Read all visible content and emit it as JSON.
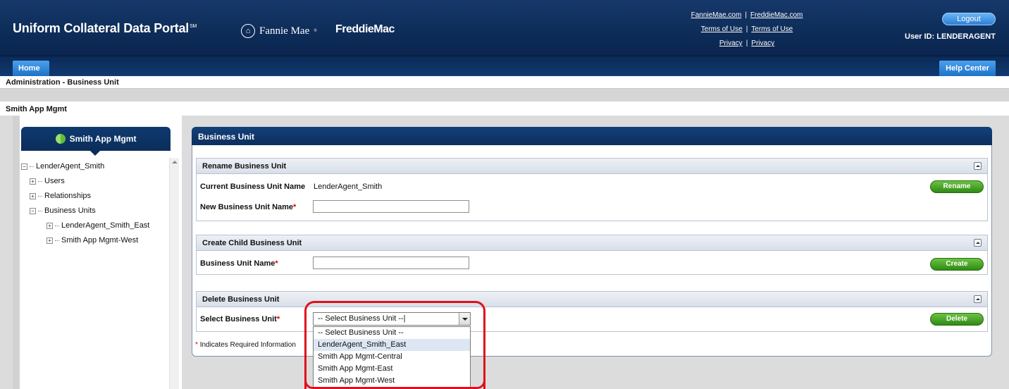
{
  "header": {
    "title": "Uniform Collateral Data Portal",
    "title_mark": "SM",
    "fannie_logo": "Fannie Mae",
    "freddie_logo": "FreddieMac",
    "links_row1": [
      "FannieMae.com",
      "FreddieMac.com"
    ],
    "links_row2": [
      "Terms of Use",
      "Terms of Use"
    ],
    "links_row3": [
      "Privacy",
      "Privacy"
    ],
    "separator": "|",
    "logout_label": "Logout",
    "user_id": "User ID: LENDERAGENT"
  },
  "nav": {
    "home_tab": "Home",
    "help_tab": "Help Center"
  },
  "breadcrumb": "Administration - Business Unit",
  "subtitle": "Smith App Mgmt",
  "left_panel": {
    "heading": "Smith App Mgmt",
    "tree": {
      "root": "LenderAgent_Smith",
      "children": [
        "Users",
        "Relationships",
        "Business Units"
      ],
      "business_units": [
        "LenderAgent_Smith_East",
        "Smith App Mgmt-West"
      ]
    }
  },
  "main": {
    "heading": "Business Unit",
    "rename": {
      "title": "Rename Business Unit",
      "current_label": "Current Business Unit Name",
      "current_value": "LenderAgent_Smith",
      "new_label": "New Business Unit Name",
      "new_value": "",
      "button": "Rename"
    },
    "create": {
      "title": "Create Child Business Unit",
      "name_label": "Business Unit Name",
      "name_value": "",
      "button": "Create"
    },
    "delete": {
      "title": "Delete Business Unit",
      "select_label": "Select Business Unit",
      "select_value": "-- Select Business Unit --|",
      "options": [
        "-- Select Business Unit --",
        "LenderAgent_Smith_East",
        "Smith App Mgmt-Central",
        "Smith App Mgmt-East",
        "Smith App Mgmt-West"
      ],
      "highlighted_option": "LenderAgent_Smith_East",
      "button": "Delete"
    },
    "required_note": "Indicates Required Information",
    "required_mark": "*"
  },
  "colors": {
    "header_navy": "#0d2c58",
    "tab_blue": "#2f86dc",
    "button_green": "#3c9a1e",
    "required_red": "#dd0000",
    "annotation_red": "#e0101c"
  }
}
